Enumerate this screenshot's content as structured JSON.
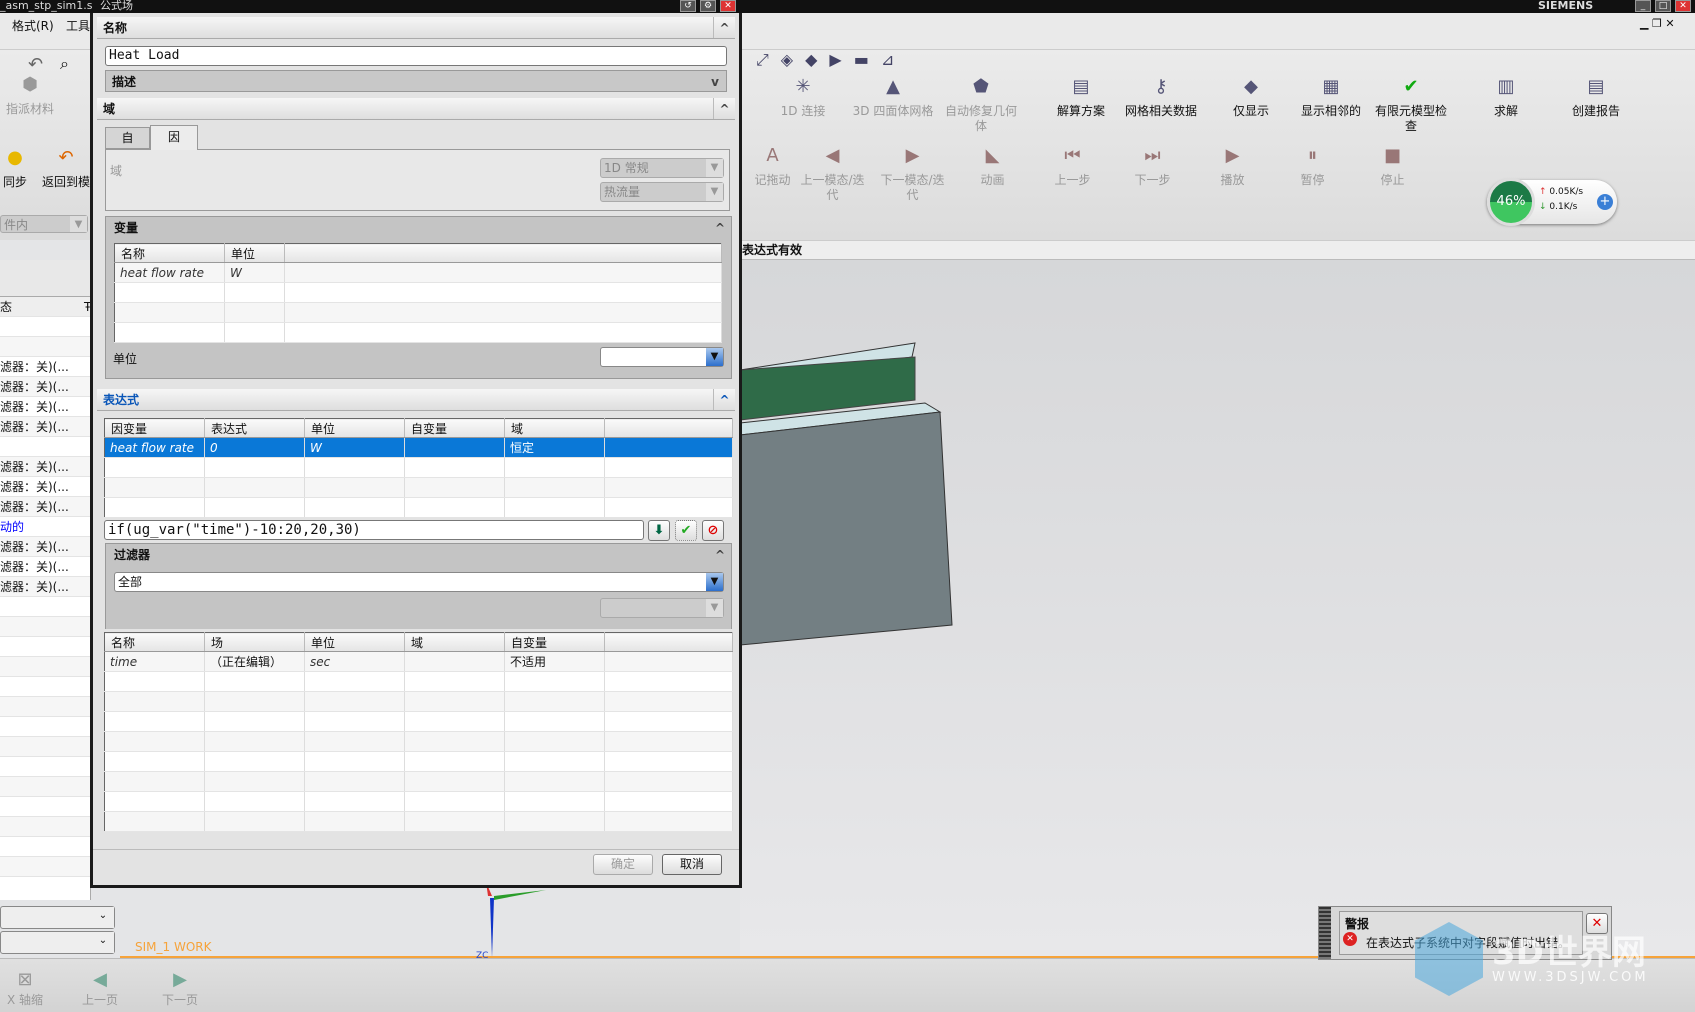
{
  "titlebar": {
    "app_title": "_asm_stp_sim1.s",
    "dialog_title": "公式场",
    "brand": "SIEMENS"
  },
  "menu": {
    "items": [
      "格式(R)",
      "工具"
    ]
  },
  "left_toolbar": {
    "assign_material": "指派材料",
    "sync": "同步",
    "return_to_model": "返回到模",
    "filter_combo": "件内"
  },
  "ribbon": {
    "row1": [
      {
        "label": "1D 连接",
        "icon": "1d-connection-icon",
        "enabled": false
      },
      {
        "label": "3D 四面体网格",
        "icon": "tetra-mesh-icon",
        "enabled": false
      },
      {
        "label": "自动修复几何体",
        "icon": "auto-repair-icon",
        "enabled": false
      },
      {
        "label": "解算方案",
        "icon": "solution-icon",
        "enabled": true
      },
      {
        "label": "网格相关数据",
        "icon": "mesh-data-icon",
        "enabled": true
      },
      {
        "label": "仅显示",
        "icon": "show-only-icon",
        "enabled": true
      },
      {
        "label": "显示相邻的",
        "icon": "show-adjacent-icon",
        "enabled": true
      },
      {
        "label": "有限元模型检查",
        "icon": "fem-check-icon",
        "enabled": true
      },
      {
        "label": "求解",
        "icon": "solve-icon",
        "enabled": true
      },
      {
        "label": "创建报告",
        "icon": "create-report-icon",
        "enabled": true
      }
    ],
    "row2": [
      {
        "label": "记拖动",
        "icon": "record-drag-icon"
      },
      {
        "label": "上一模态/迭代",
        "icon": "prev-mode-icon"
      },
      {
        "label": "下一模态/迭代",
        "icon": "next-mode-icon"
      },
      {
        "label": "动画",
        "icon": "animation-icon"
      },
      {
        "label": "上一步",
        "icon": "step-back-icon"
      },
      {
        "label": "下一步",
        "icon": "step-forward-icon"
      },
      {
        "label": "播放",
        "icon": "play-icon"
      },
      {
        "label": "暂停",
        "icon": "pause-icon"
      },
      {
        "label": "停止",
        "icon": "stop-icon"
      }
    ]
  },
  "network_widget": {
    "percent": "46%",
    "up": "0.05K/s",
    "down": "0.1K/s"
  },
  "status_line": "表达式有效",
  "left_panel": {
    "headers": [
      "态",
      "Ŧ"
    ],
    "rows": [
      "",
      "",
      "滤器：关)(...",
      "滤器：关)(...",
      "滤器：关)(...",
      "滤器：关)(...",
      "",
      "滤器：关)(...",
      "滤器：关)(...",
      "滤器：关)(...",
      "动的",
      "滤器：关)(...",
      "滤器：关)(...",
      "滤器：关)(..."
    ]
  },
  "dialog": {
    "name_section": "名称",
    "name_value": "Heat Load",
    "description_section": "描述",
    "domain_section": "域",
    "tabs": [
      "自",
      "因"
    ],
    "active_tab": 1,
    "domain_label": "域",
    "domain_combo1": "1D 常规",
    "domain_combo2": "热流量",
    "variables_section": "变量",
    "variables_table": {
      "headers": [
        "名称",
        "单位"
      ],
      "rows": [
        [
          "heat flow rate",
          "W"
        ]
      ]
    },
    "unit_label": "单位",
    "unit_value": "",
    "expression_section": "表达式",
    "expression_table": {
      "headers": [
        "因变量",
        "表达式",
        "单位",
        "自变量",
        "域",
        ""
      ],
      "rows": [
        [
          "heat flow rate",
          "0",
          "W",
          "",
          "恒定",
          ""
        ]
      ]
    },
    "formula": "if(ug_var(\"time\")-10:20,20,30)",
    "filter_section": "过滤器",
    "filter_value": "全部",
    "filter_table": {
      "headers": [
        "名称",
        "场",
        "单位",
        "域",
        "自变量",
        ""
      ],
      "rows": [
        [
          "time",
          "（正在编辑）",
          "sec",
          "",
          "不适用",
          ""
        ]
      ]
    },
    "ok": "确定",
    "cancel": "取消"
  },
  "viewport": {
    "label": "SIM_1 WORK",
    "axis_label": "ZC"
  },
  "bottom_toolbar": {
    "x_axis": "X 轴缩",
    "prev_page": "上一页",
    "next_page": "下一页"
  },
  "alert": {
    "title": "警报",
    "message": "在表达式子系统中对字段赋值时出错。"
  },
  "watermark": {
    "text": "3D世界网",
    "url": "WWW.3DSJW.COM"
  }
}
